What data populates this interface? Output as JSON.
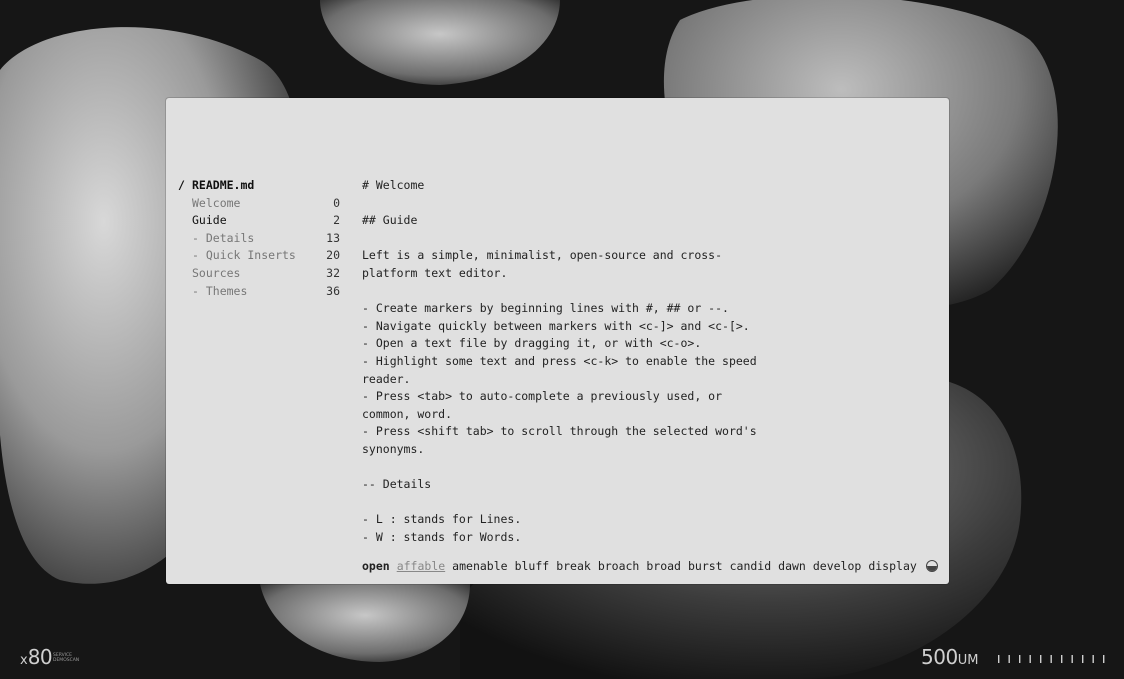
{
  "navigator": {
    "selected_marker": "/",
    "file_name": "README.md",
    "items": [
      {
        "label": "Welcome",
        "line": "0"
      },
      {
        "label": "Guide",
        "line": "2"
      },
      {
        "label": "- Details",
        "line": "13"
      },
      {
        "label": "- Quick Inserts",
        "line": "20"
      },
      {
        "label": "Sources",
        "line": "32"
      },
      {
        "label": "- Themes",
        "line": "36"
      }
    ]
  },
  "editor": {
    "lines": [
      "# Welcome",
      "",
      "## Guide",
      "",
      "Left is a simple, minimalist, open-source and cross-",
      "platform text editor.",
      "",
      "- Create markers by beginning lines with #, ## or --.",
      "- Navigate quickly between markers with <c-]> and <c-[>.",
      "- Open a text file by dragging it, or with <c-o>.",
      "- Highlight some text and press <c-k> to enable the speed",
      "reader.",
      "- Press <tab> to auto-complete a previously used, or",
      "common, word.",
      "- Press <shift tab> to scroll through the selected word's",
      "synonyms.",
      "",
      "-- Details",
      "",
      "- L : stands for Lines.",
      "- W : stands for Words."
    ]
  },
  "suggestions": {
    "current_word": "open",
    "selected": "affable",
    "words": [
      "amenable",
      "bluff",
      "break",
      "broach",
      "broad",
      "burst",
      "candid",
      "dawn",
      "develop",
      "display"
    ]
  },
  "hud": {
    "x_prefix": "x",
    "magnification": "80",
    "meta_line_1": "SERVICE",
    "meta_line_2": "DEMOSCAN",
    "scale_value": "500",
    "scale_unit": "UM"
  },
  "colors": {
    "background": "#161616",
    "window": "#e0e0e0",
    "text": "#222222",
    "dim_text": "#777777"
  }
}
